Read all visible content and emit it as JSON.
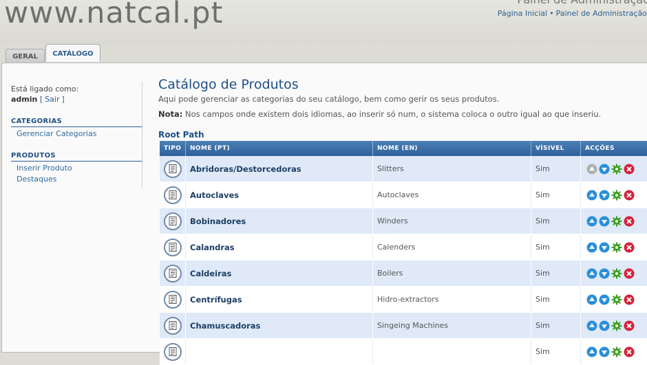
{
  "header": {
    "site_name": "www.natcal.pt",
    "panel_title": "Painel de Administração",
    "links": [
      "Página Inicial",
      "Painel de Administração"
    ],
    "separator": "•"
  },
  "tabs": [
    {
      "label": "GERAL",
      "active": false
    },
    {
      "label": "CATÁLOGO",
      "active": true
    }
  ],
  "sidebar": {
    "login_label": "Está ligado como:",
    "username": "admin",
    "logout_open": "[",
    "logout_label": "Sair",
    "logout_close": "]",
    "sections": [
      {
        "heading": "CATEGORIAS",
        "items": [
          "Gerenciar Categorias"
        ]
      },
      {
        "heading": "PRODUTOS",
        "items": [
          "Inserir Produto",
          "Destaques"
        ]
      }
    ]
  },
  "main": {
    "title": "Catálogo de Produtos",
    "description": "Aqui pode gerenciar as categorias do seu catálogo, bem como gerir os seus produtos.",
    "note_label": "Nota:",
    "note_text": "Nos campos onde existem dois idiomas, ao inserir só num, o sistema coloca o outro igual ao que inseriu.",
    "root_path": "Root Path"
  },
  "table": {
    "headers": [
      "TIPO",
      "NOME (PT)",
      "NOME (EN)",
      "VÍSIVEL",
      "ACÇÕES"
    ],
    "rows": [
      {
        "pt": "Abridoras/Destorcedoras",
        "en": "Slitters",
        "visible": "Sim",
        "up_disabled": true
      },
      {
        "pt": "Autoclaves",
        "en": "Autoclaves",
        "visible": "Sim",
        "up_disabled": false
      },
      {
        "pt": "Bobinadores",
        "en": "Winders",
        "visible": "Sim",
        "up_disabled": false
      },
      {
        "pt": "Calandras",
        "en": "Calenders",
        "visible": "Sim",
        "up_disabled": false
      },
      {
        "pt": "Caldeiras",
        "en": "Boilers",
        "visible": "Sim",
        "up_disabled": false
      },
      {
        "pt": "Centrífugas",
        "en": "Hidro-extractors",
        "visible": "Sim",
        "up_disabled": false
      },
      {
        "pt": "Chamuscadoras",
        "en": "Singeing Machines",
        "visible": "Sim",
        "up_disabled": false
      },
      {
        "pt": "",
        "en": "",
        "visible": "Sim",
        "up_disabled": false
      }
    ]
  },
  "icons": {
    "type": "document-icon",
    "up": "arrow-up-icon",
    "down": "arrow-down-icon",
    "edit": "gear-icon",
    "delete": "delete-icon"
  },
  "colors": {
    "accent": "#1e4f86",
    "table_header": "#2f629b",
    "up_down": "#2a8fd9",
    "edit": "#3aa020",
    "delete": "#d8203a",
    "disabled": "#b0b0b0"
  }
}
